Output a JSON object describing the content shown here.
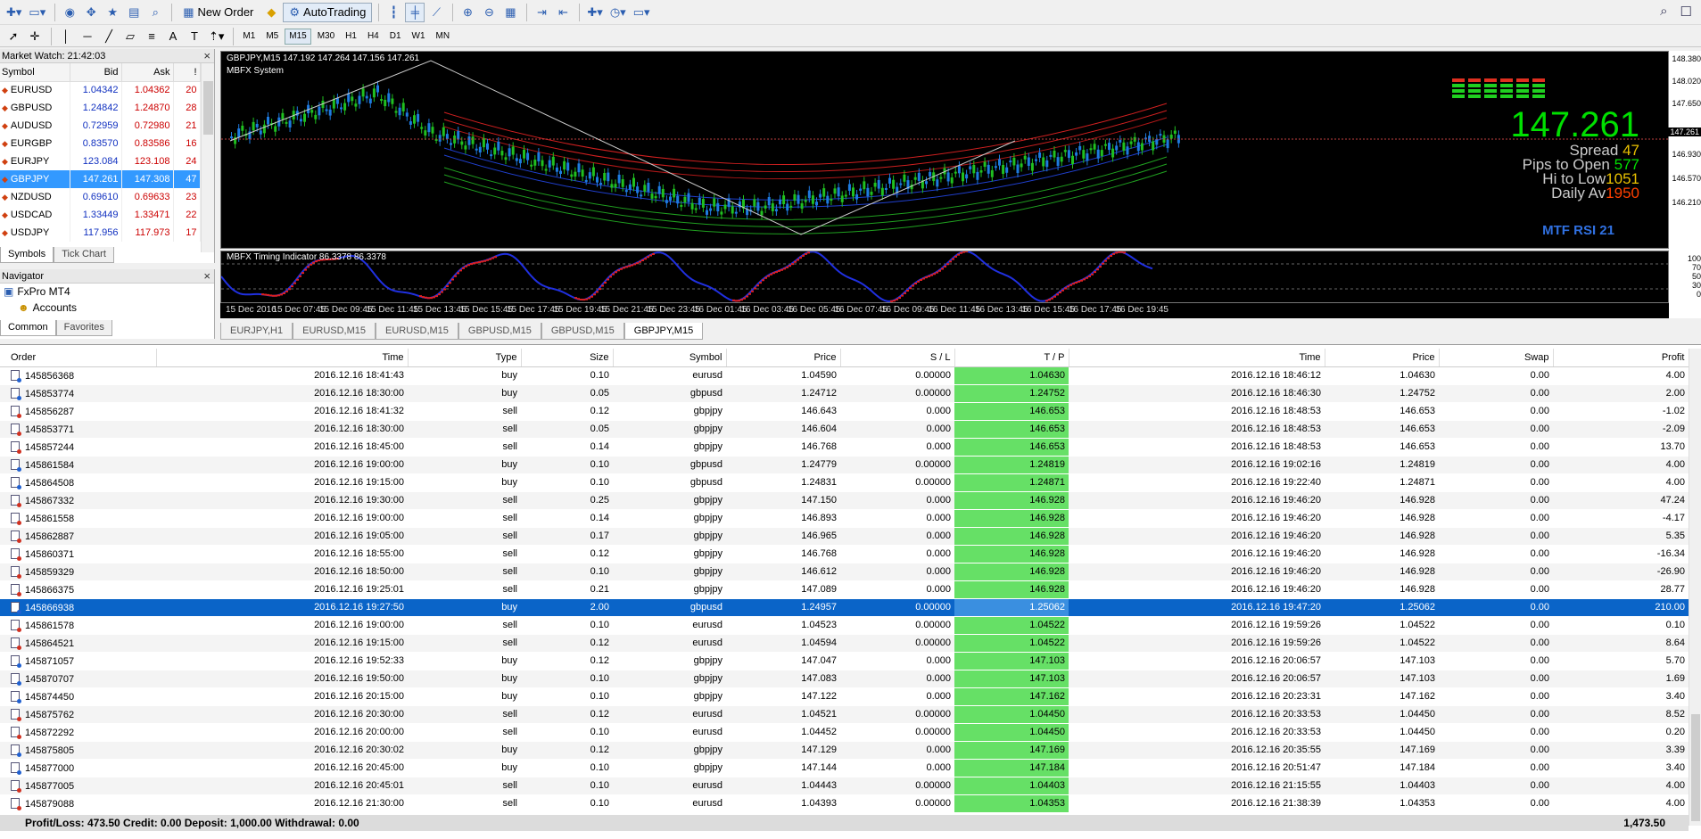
{
  "toolbar": {
    "new_order": "New Order",
    "autotrading": "AutoTrading",
    "timeframes": [
      "M1",
      "M5",
      "M15",
      "M30",
      "H1",
      "H4",
      "D1",
      "W1",
      "MN"
    ],
    "active_tf": "M15"
  },
  "market_watch": {
    "title": "Market Watch: 21:42:03",
    "headers": {
      "symbol": "Symbol",
      "bid": "Bid",
      "ask": "Ask",
      "spread": "!"
    },
    "rows": [
      {
        "symbol": "EURUSD",
        "bid": "1.04342",
        "ask": "1.04362",
        "spread": "20"
      },
      {
        "symbol": "GBPUSD",
        "bid": "1.24842",
        "ask": "1.24870",
        "spread": "28"
      },
      {
        "symbol": "AUDUSD",
        "bid": "0.72959",
        "ask": "0.72980",
        "spread": "21"
      },
      {
        "symbol": "EURGBP",
        "bid": "0.83570",
        "ask": "0.83586",
        "spread": "16"
      },
      {
        "symbol": "EURJPY",
        "bid": "123.084",
        "ask": "123.108",
        "spread": "24"
      },
      {
        "symbol": "GBPJPY",
        "bid": "147.261",
        "ask": "147.308",
        "spread": "47"
      },
      {
        "symbol": "NZDUSD",
        "bid": "0.69610",
        "ask": "0.69633",
        "spread": "23"
      },
      {
        "symbol": "USDCAD",
        "bid": "1.33449",
        "ask": "1.33471",
        "spread": "22"
      },
      {
        "symbol": "USDJPY",
        "bid": "117.956",
        "ask": "117.973",
        "spread": "17"
      }
    ],
    "tabs": [
      "Symbols",
      "Tick Chart"
    ]
  },
  "navigator": {
    "title": "Navigator",
    "root": "FxPro MT4",
    "item": "Accounts",
    "tabs": [
      "Common",
      "Favorites"
    ]
  },
  "chart": {
    "symbol_line": "GBPJPY,M15  147.192 147.264 147.156 147.261",
    "system_label": "MBFX System",
    "big_price": "147.261",
    "spread_label": "Spread",
    "spread_value": "47",
    "pips_label": "Pips to Open",
    "pips_value": "577",
    "hilo_label": "Hi to Low",
    "hilo_value": "1051",
    "daily_label": "Daily Av",
    "daily_value": "1950",
    "mtf_label": "MTF RSI  21",
    "indicator_label": "MBFX Timing Indicator 86.3378 86.3378",
    "price_axis": [
      "148.380",
      "148.020",
      "147.650",
      "147.261",
      "146.930",
      "146.570",
      "146.210"
    ],
    "ind_axis": [
      "100",
      "70",
      "50",
      "30",
      "0"
    ],
    "time_labels": [
      "15 Dec 2016",
      "15 Dec 07:45",
      "15 Dec 09:45",
      "15 Dec 11:45",
      "15 Dec 13:45",
      "15 Dec 15:45",
      "15 Dec 17:45",
      "15 Dec 19:45",
      "15 Dec 21:45",
      "15 Dec 23:45",
      "16 Dec 01:45",
      "16 Dec 03:45",
      "16 Dec 05:45",
      "16 Dec 07:45",
      "16 Dec 09:45",
      "16 Dec 11:45",
      "16 Dec 13:45",
      "16 Dec 15:45",
      "16 Dec 17:45",
      "16 Dec 19:45"
    ],
    "tabs": [
      "EURJPY,H1",
      "EURUSD,M15",
      "EURUSD,M15",
      "GBPUSD,M15",
      "GBPUSD,M15",
      "GBPJPY,M15"
    ],
    "active_tab": 5
  },
  "terminal": {
    "headers": [
      "Order",
      "Time",
      "Type",
      "Size",
      "Symbol",
      "Price",
      "S / L",
      "T / P",
      "Time",
      "Price",
      "Swap",
      "Profit"
    ],
    "rows": [
      [
        "145856368",
        "2016.12.16 18:41:43",
        "buy",
        "0.10",
        "eurusd",
        "1.04590",
        "0.00000",
        "1.04630",
        "2016.12.16 18:46:12",
        "1.04630",
        "0.00",
        "4.00"
      ],
      [
        "145853774",
        "2016.12.16 18:30:00",
        "buy",
        "0.05",
        "gbpusd",
        "1.24712",
        "0.00000",
        "1.24752",
        "2016.12.16 18:46:30",
        "1.24752",
        "0.00",
        "2.00"
      ],
      [
        "145856287",
        "2016.12.16 18:41:32",
        "sell",
        "0.12",
        "gbpjpy",
        "146.643",
        "0.000",
        "146.653",
        "2016.12.16 18:48:53",
        "146.653",
        "0.00",
        "-1.02"
      ],
      [
        "145853771",
        "2016.12.16 18:30:00",
        "sell",
        "0.05",
        "gbpjpy",
        "146.604",
        "0.000",
        "146.653",
        "2016.12.16 18:48:53",
        "146.653",
        "0.00",
        "-2.09"
      ],
      [
        "145857244",
        "2016.12.16 18:45:00",
        "sell",
        "0.14",
        "gbpjpy",
        "146.768",
        "0.000",
        "146.653",
        "2016.12.16 18:48:53",
        "146.653",
        "0.00",
        "13.70"
      ],
      [
        "145861584",
        "2016.12.16 19:00:00",
        "buy",
        "0.10",
        "gbpusd",
        "1.24779",
        "0.00000",
        "1.24819",
        "2016.12.16 19:02:16",
        "1.24819",
        "0.00",
        "4.00"
      ],
      [
        "145864508",
        "2016.12.16 19:15:00",
        "buy",
        "0.10",
        "gbpusd",
        "1.24831",
        "0.00000",
        "1.24871",
        "2016.12.16 19:22:40",
        "1.24871",
        "0.00",
        "4.00"
      ],
      [
        "145867332",
        "2016.12.16 19:30:00",
        "sell",
        "0.25",
        "gbpjpy",
        "147.150",
        "0.000",
        "146.928",
        "2016.12.16 19:46:20",
        "146.928",
        "0.00",
        "47.24"
      ],
      [
        "145861558",
        "2016.12.16 19:00:00",
        "sell",
        "0.14",
        "gbpjpy",
        "146.893",
        "0.000",
        "146.928",
        "2016.12.16 19:46:20",
        "146.928",
        "0.00",
        "-4.17"
      ],
      [
        "145862887",
        "2016.12.16 19:05:00",
        "sell",
        "0.17",
        "gbpjpy",
        "146.965",
        "0.000",
        "146.928",
        "2016.12.16 19:46:20",
        "146.928",
        "0.00",
        "5.35"
      ],
      [
        "145860371",
        "2016.12.16 18:55:00",
        "sell",
        "0.12",
        "gbpjpy",
        "146.768",
        "0.000",
        "146.928",
        "2016.12.16 19:46:20",
        "146.928",
        "0.00",
        "-16.34"
      ],
      [
        "145859329",
        "2016.12.16 18:50:00",
        "sell",
        "0.10",
        "gbpjpy",
        "146.612",
        "0.000",
        "146.928",
        "2016.12.16 19:46:20",
        "146.928",
        "0.00",
        "-26.90"
      ],
      [
        "145866375",
        "2016.12.16 19:25:01",
        "sell",
        "0.21",
        "gbpjpy",
        "147.089",
        "0.000",
        "146.928",
        "2016.12.16 19:46:20",
        "146.928",
        "0.00",
        "28.77"
      ],
      [
        "145866938",
        "2016.12.16 19:27:50",
        "buy",
        "2.00",
        "gbpusd",
        "1.24957",
        "0.00000",
        "1.25062",
        "2016.12.16 19:47:20",
        "1.25062",
        "0.00",
        "210.00"
      ],
      [
        "145861578",
        "2016.12.16 19:00:00",
        "sell",
        "0.10",
        "eurusd",
        "1.04523",
        "0.00000",
        "1.04522",
        "2016.12.16 19:59:26",
        "1.04522",
        "0.00",
        "0.10"
      ],
      [
        "145864521",
        "2016.12.16 19:15:00",
        "sell",
        "0.12",
        "eurusd",
        "1.04594",
        "0.00000",
        "1.04522",
        "2016.12.16 19:59:26",
        "1.04522",
        "0.00",
        "8.64"
      ],
      [
        "145871057",
        "2016.12.16 19:52:33",
        "buy",
        "0.12",
        "gbpjpy",
        "147.047",
        "0.000",
        "147.103",
        "2016.12.16 20:06:57",
        "147.103",
        "0.00",
        "5.70"
      ],
      [
        "145870707",
        "2016.12.16 19:50:00",
        "buy",
        "0.10",
        "gbpjpy",
        "147.083",
        "0.000",
        "147.103",
        "2016.12.16 20:06:57",
        "147.103",
        "0.00",
        "1.69"
      ],
      [
        "145874450",
        "2016.12.16 20:15:00",
        "buy",
        "0.10",
        "gbpjpy",
        "147.122",
        "0.000",
        "147.162",
        "2016.12.16 20:23:31",
        "147.162",
        "0.00",
        "3.40"
      ],
      [
        "145875762",
        "2016.12.16 20:30:00",
        "sell",
        "0.12",
        "eurusd",
        "1.04521",
        "0.00000",
        "1.04450",
        "2016.12.16 20:33:53",
        "1.04450",
        "0.00",
        "8.52"
      ],
      [
        "145872292",
        "2016.12.16 20:00:00",
        "sell",
        "0.10",
        "eurusd",
        "1.04452",
        "0.00000",
        "1.04450",
        "2016.12.16 20:33:53",
        "1.04450",
        "0.00",
        "0.20"
      ],
      [
        "145875805",
        "2016.12.16 20:30:02",
        "buy",
        "0.12",
        "gbpjpy",
        "147.129",
        "0.000",
        "147.169",
        "2016.12.16 20:35:55",
        "147.169",
        "0.00",
        "3.39"
      ],
      [
        "145877000",
        "2016.12.16 20:45:00",
        "buy",
        "0.10",
        "gbpjpy",
        "147.144",
        "0.000",
        "147.184",
        "2016.12.16 20:51:47",
        "147.184",
        "0.00",
        "3.40"
      ],
      [
        "145877005",
        "2016.12.16 20:45:01",
        "sell",
        "0.10",
        "eurusd",
        "1.04443",
        "0.00000",
        "1.04403",
        "2016.12.16 21:15:55",
        "1.04403",
        "0.00",
        "4.00"
      ],
      [
        "145879088",
        "2016.12.16 21:30:00",
        "sell",
        "0.10",
        "eurusd",
        "1.04393",
        "0.00000",
        "1.04353",
        "2016.12.16 21:38:39",
        "1.04353",
        "0.00",
        "4.00"
      ]
    ],
    "selected_row": 13,
    "summary": "Profit/Loss: 473.50  Credit: 0.00  Deposit: 1,000.00  Withdrawal: 0.00",
    "total": "1,473.50"
  }
}
